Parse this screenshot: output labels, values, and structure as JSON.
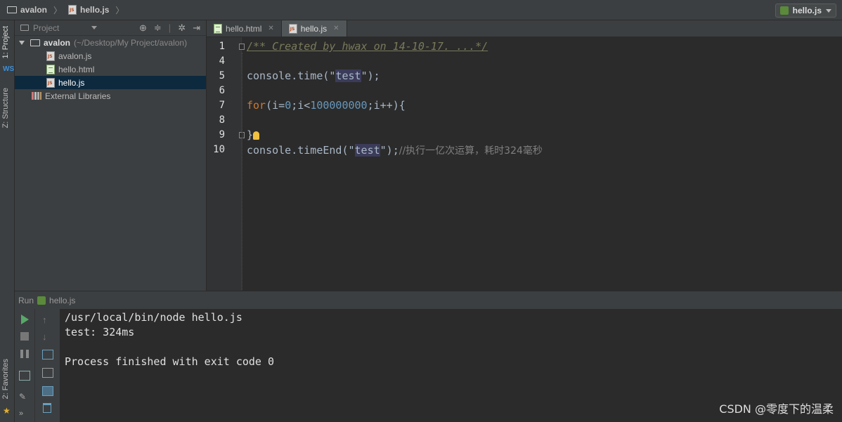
{
  "breadcrumb": {
    "project": "avalon",
    "file": "hello.js"
  },
  "run_config": {
    "label": "hello.js"
  },
  "left_strip": {
    "project_tab": "1: Project",
    "structure_tab": "Z: Structure",
    "favorites_tab": "2: Favorites"
  },
  "project_panel": {
    "header": "Project",
    "root": {
      "name": "avalon",
      "path": "(~/Desktop/My Project/avalon)"
    },
    "files": [
      {
        "name": "avalon.js",
        "icon": "js-file-icon"
      },
      {
        "name": "hello.html",
        "icon": "html-file-icon"
      },
      {
        "name": "hello.js",
        "icon": "js-file-icon",
        "selected": true
      }
    ],
    "external": "External Libraries"
  },
  "tabs": [
    {
      "label": "hello.html",
      "active": false
    },
    {
      "label": "hello.js",
      "active": true
    }
  ],
  "editor": {
    "lines": [
      {
        "num": "1",
        "comment": "/** Created by hwax on 14-10-17. ...*/"
      },
      {
        "num": "4"
      },
      {
        "num": "5",
        "a": "console.time(\"",
        "hl": "test",
        "b": "\");"
      },
      {
        "num": "6"
      },
      {
        "num": "7",
        "kw": "for",
        "p1": "(i=",
        "n1": "0",
        "p2": ";i<",
        "n2": "100000000",
        "p3": ";i++){"
      },
      {
        "num": "8"
      },
      {
        "num": "9",
        "brace": "}"
      },
      {
        "num": "10",
        "a": "console.timeEnd(\"",
        "hl": "test",
        "b": "\");",
        "comment": "//执行一亿次运算，耗时324毫秒"
      }
    ]
  },
  "run": {
    "label": "Run",
    "config": "hello.js"
  },
  "console": {
    "lines": [
      "/usr/local/bin/node hello.js",
      "test: 324ms",
      "",
      "Process finished with exit code 0"
    ]
  },
  "watermark": "CSDN @零度下的温柔"
}
